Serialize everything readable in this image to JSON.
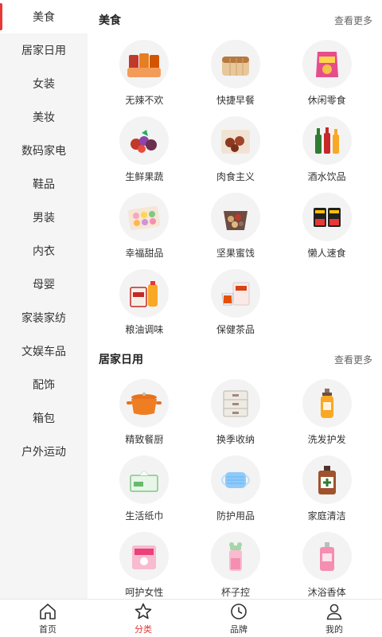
{
  "sidebar": {
    "items": [
      {
        "label": "美食"
      },
      {
        "label": "居家日用"
      },
      {
        "label": "女装"
      },
      {
        "label": "美妆"
      },
      {
        "label": "数码家电"
      },
      {
        "label": "鞋品"
      },
      {
        "label": "男装"
      },
      {
        "label": "内衣"
      },
      {
        "label": "母婴"
      },
      {
        "label": "家装家纺"
      },
      {
        "label": "文娱车品"
      },
      {
        "label": "配饰"
      },
      {
        "label": "箱包"
      },
      {
        "label": "户外运动"
      }
    ],
    "active_index": 0
  },
  "sections": [
    {
      "title": "美食",
      "more": "查看更多",
      "items": [
        {
          "label": "无辣不欢",
          "icon": "spicy-snack-icon"
        },
        {
          "label": "快捷早餐",
          "icon": "bread-icon"
        },
        {
          "label": "休闲零食",
          "icon": "chips-bag-icon"
        },
        {
          "label": "生鲜果蔬",
          "icon": "fruit-icon"
        },
        {
          "label": "肉食主义",
          "icon": "meatball-icon"
        },
        {
          "label": "酒水饮品",
          "icon": "bottles-icon"
        },
        {
          "label": "幸福甜品",
          "icon": "macaron-box-icon"
        },
        {
          "label": "坚果蜜饯",
          "icon": "nuts-icon"
        },
        {
          "label": "懒人速食",
          "icon": "instant-noodle-icon"
        },
        {
          "label": "粮油调味",
          "icon": "rice-oil-icon"
        },
        {
          "label": "保健茶品",
          "icon": "tea-icon"
        }
      ]
    },
    {
      "title": "居家日用",
      "more": "查看更多",
      "items": [
        {
          "label": "精致餐厨",
          "icon": "pot-icon"
        },
        {
          "label": "换季收纳",
          "icon": "storage-box-icon"
        },
        {
          "label": "洗发护发",
          "icon": "shampoo-icon"
        },
        {
          "label": "生活纸巾",
          "icon": "tissue-icon"
        },
        {
          "label": "防护用品",
          "icon": "mask-icon"
        },
        {
          "label": "家庭清洁",
          "icon": "disinfectant-icon"
        },
        {
          "label": "呵护女性",
          "icon": "pad-icon"
        },
        {
          "label": "杯子控",
          "icon": "cup-icon"
        },
        {
          "label": "沐浴香体",
          "icon": "perfume-icon"
        }
      ]
    }
  ],
  "tabbar": {
    "items": [
      {
        "label": "首页",
        "icon": "home-icon"
      },
      {
        "label": "分类",
        "icon": "star-icon"
      },
      {
        "label": "品牌",
        "icon": "clock-icon"
      },
      {
        "label": "我的",
        "icon": "user-icon"
      }
    ],
    "active_index": 1
  },
  "colors": {
    "accent": "#e53935",
    "sidebar_bg": "#f5f5f5"
  }
}
